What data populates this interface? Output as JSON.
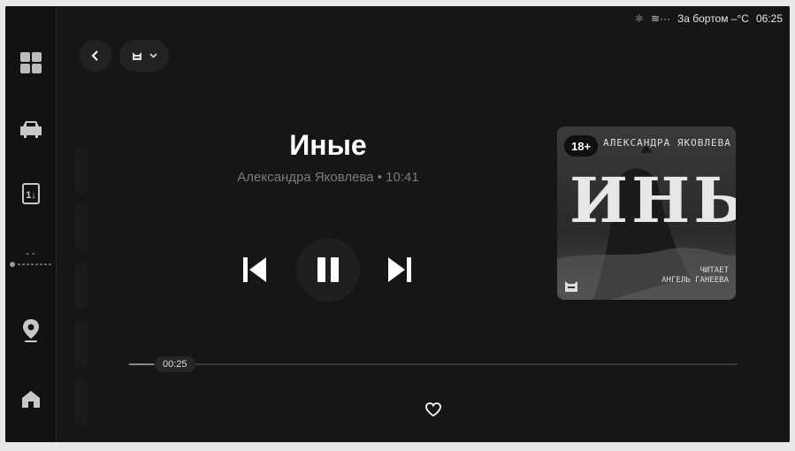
{
  "statusbar": {
    "outside_label": "За бортом –°C",
    "time": "06:25"
  },
  "sidebar": {
    "items": [
      {
        "icon": "apps-grid-icon"
      },
      {
        "icon": "car-icon"
      },
      {
        "icon": "phone-sim-icon"
      },
      {
        "icon": "climate-fan-icon",
        "label": "- -"
      },
      {
        "icon": "location-pin-icon"
      },
      {
        "icon": "home-icon"
      }
    ]
  },
  "header": {
    "back_icon": "chevron-left-icon",
    "source_icon": "cat-logo-icon",
    "dropdown_icon": "chevron-down-icon"
  },
  "player": {
    "title": "Иные",
    "subtitle": "Александра Яковлева • 10:41",
    "elapsed": "00:25",
    "progress": 0.04
  },
  "cover": {
    "age_badge": "18+",
    "author": "АЛЕКСАНДРА ЯКОВЛЕВА",
    "title": "ИНЫЕ",
    "narrator_line1": "ЧИТАЕТ",
    "narrator_line2": "АНГЕЛЬ ГАНЕЕВА"
  },
  "colors": {
    "background": "#161616",
    "text_primary": "#ffffff",
    "text_secondary": "#7a7a7a"
  }
}
